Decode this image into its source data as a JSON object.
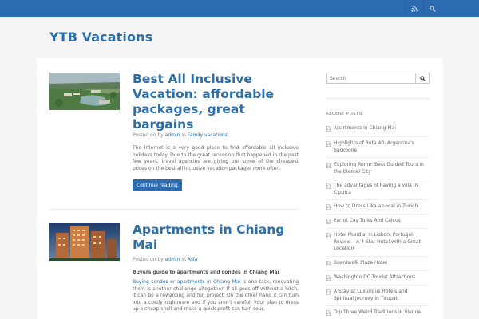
{
  "header": {
    "site_title": "YTB Vacations",
    "icons": [
      "rss-icon",
      "search-icon"
    ],
    "bar_color": "#2d6bb0"
  },
  "posts": [
    {
      "title": "Best All Inclusive Vacation: affordable packages, great bargains",
      "meta_prefix": "Posted on by",
      "author": "admin",
      "meta_in": "in",
      "category": "Family vacations",
      "excerpt": "The Internet is a very good place to find affordable all inclusive holidays today. Due to the great recession that happened in the past few years, travel agencies are giving out some of the cheapest prices on the best all inclusive vacation packages more often.",
      "button": "Continue reading"
    },
    {
      "title": "Apartments in Chiang Mai",
      "meta_prefix": "Posted on by",
      "author": "admin",
      "meta_in": "in",
      "category": "Asia",
      "subheading": "Buyers guide to apartments and condos in Chiang Mai",
      "excerpt_link": "Buying condos or apartments in Chiang Mai",
      "excerpt": " is one task, renovating them is another challenge altogether. If all goes off without a hitch, it can be a rewarding and fun project. On the other hand it can turn into a costly nightmare and if you aren't careful, your plan to dress up a cheap shell and make a quick profit can turn sour."
    }
  ],
  "sidebar": {
    "search_placeholder": "Search",
    "recent_heading": "RECENT POSTS",
    "recent_posts": [
      "Apartments in Chiang Mai",
      "Highlights of Ruta 40: Argentina's backbone",
      "Exploring Rome: Best Guided Tours in the Eternal City",
      "The advantages of having a villa in Ciputra",
      "How to Dress Like a Local in Zurich",
      "Parrot Cay Turks And Caicos",
      "Hotel Mundial in Lisbon, Portugal: Review – A 4 Star Hotel with a Great Location",
      "Boardwalk Plaza Hotel",
      "Washington DC Tourist Attractions",
      "A Stay at Luxurious Hotels and Spiritual Journey in Tirupati",
      "Top Three Weird Traditions in Vienna"
    ]
  }
}
